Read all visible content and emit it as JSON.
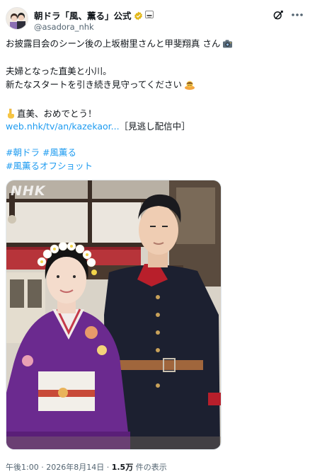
{
  "account": {
    "display_name": "朝ドラ「風、薫る」公式",
    "handle": "@asadora_nhk"
  },
  "post": {
    "line1": "お披露目会のシーン後の上坂樹里さんと甲斐翔真 さん",
    "line2": "夫婦となった直美と小川。",
    "line3": "新たなスタートを引き続き見守ってください",
    "line4": "直美、おめでとう！",
    "link_text": "web.nhk/tv/an/kazekaor...",
    "link_suffix": "［見逃し配信中］",
    "hashtag_line1": "#朝ドラ #風薫る",
    "hashtag_line2": "#風薫るオフショット"
  },
  "media": {
    "watermark": "NHK"
  },
  "footer": {
    "time": "午後1:00",
    "separator1": " · ",
    "date": "2026年8月14日",
    "separator2": " · ",
    "views_count": "1.5万",
    "views_label": " 件の表示"
  },
  "icons": {
    "verified": "verified-badge-icon",
    "affiliate": "affiliate-badge-icon",
    "grok": "grok-icon",
    "more": "more-icon",
    "camera": "camera-emoji-icon",
    "bowing": "bowing-person-emoji-icon",
    "pointing": "pointing-down-emoji-icon"
  },
  "colors": {
    "link": "#1d9bf0",
    "text": "#0f1419",
    "secondary": "#536471",
    "verified_gold": "#e2b719"
  }
}
